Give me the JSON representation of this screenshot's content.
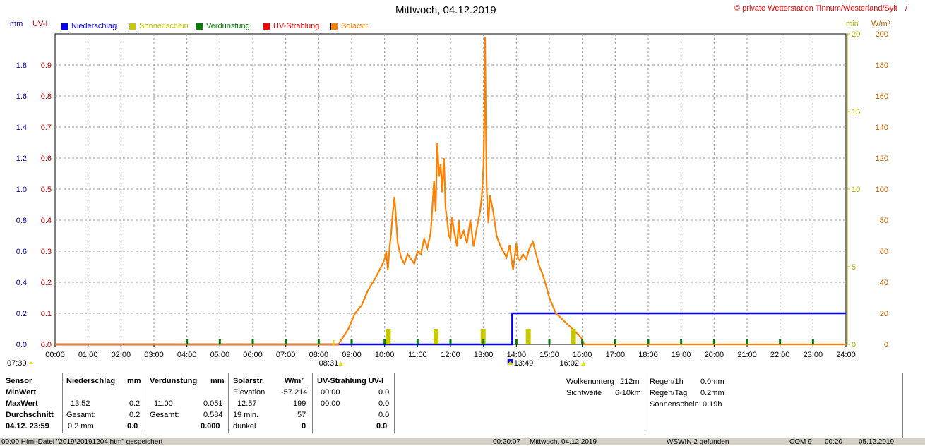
{
  "title": "Mittwoch, 04.12.2019",
  "copyright": "© private Wetterstation Tinnum/Westerland/Sylt",
  "copyright_tail": "/",
  "units": {
    "left1": "mm",
    "left2": "UV-I",
    "right1": "min",
    "right2": "W/m²"
  },
  "legend": [
    {
      "label": "Niederschlag",
      "color": "#0000ff",
      "text_color": "#0000ff"
    },
    {
      "label": "Sonnenschein",
      "color": "#c8c800",
      "text_color": "#c8c800"
    },
    {
      "label": "Verdunstung",
      "color": "#008000",
      "text_color": "#008000"
    },
    {
      "label": "UV-Strahlung",
      "color": "#ff0000",
      "text_color": "#ff0000"
    },
    {
      "label": "Solarstr.",
      "color": "#ff8000",
      "text_color": "#ff8000"
    }
  ],
  "colors": {
    "grid": "#999999",
    "mm_axis": "#0000a0",
    "uv_axis": "#c00000",
    "min_axis": "#b0b000",
    "wm_axis": "#c06000"
  },
  "chart_data": {
    "type": "line",
    "x_axis": {
      "ticks": [
        "00:00",
        "01:00",
        "02:00",
        "03:00",
        "04:00",
        "05:00",
        "06:00",
        "07:00",
        "08:00",
        "09:00",
        "10:00",
        "11:00",
        "12:00",
        "13:00",
        "14:00",
        "15:00",
        "16:00",
        "17:00",
        "18:00",
        "19:00",
        "20:00",
        "21:00",
        "22:00",
        "23:00",
        "24:00"
      ],
      "range_hours": [
        0,
        24
      ]
    },
    "y_left_mm": {
      "ticks": [
        "0.0",
        "0.2",
        "0.4",
        "0.6",
        "0.8",
        "1.0",
        "1.2",
        "1.4",
        "1.6",
        "1.8"
      ],
      "range": [
        0,
        2.0
      ]
    },
    "y_left_uv": {
      "ticks": [
        "0.0",
        "0.1",
        "0.2",
        "0.3",
        "0.4",
        "0.5",
        "0.6",
        "0.7",
        "0.8",
        "0.9"
      ],
      "range": [
        0,
        1.0
      ]
    },
    "y_right_min": {
      "ticks": [
        "0",
        "5",
        "10",
        "15",
        "20"
      ],
      "range": [
        0,
        20
      ]
    },
    "y_right_wm": {
      "ticks": [
        "0",
        "20",
        "40",
        "60",
        "80",
        "100",
        "120",
        "140",
        "160",
        "180",
        "200"
      ],
      "range": [
        0,
        200
      ]
    },
    "markers": {
      "sunrise": "08:31",
      "sunset": "16:02",
      "sunrise_left": "07:30",
      "max_mark": "13:49"
    },
    "series": [
      {
        "name": "Niederschlag",
        "unit": "mm",
        "color": "#0000ff",
        "points": [
          [
            0,
            0
          ],
          [
            13.87,
            0
          ],
          [
            13.87,
            0.2
          ],
          [
            24,
            0.2
          ]
        ]
      },
      {
        "name": "Solarstr.",
        "unit": "W/m²",
        "color": "#ff8000",
        "points": [
          [
            0,
            0
          ],
          [
            8.6,
            0
          ],
          [
            8.75,
            5
          ],
          [
            8.9,
            10
          ],
          [
            9.1,
            20
          ],
          [
            9.3,
            25
          ],
          [
            9.5,
            35
          ],
          [
            9.7,
            42
          ],
          [
            9.9,
            50
          ],
          [
            10.0,
            55
          ],
          [
            10.05,
            60
          ],
          [
            10.1,
            48
          ],
          [
            10.15,
            62
          ],
          [
            10.2,
            72
          ],
          [
            10.25,
            85
          ],
          [
            10.3,
            95
          ],
          [
            10.35,
            80
          ],
          [
            10.4,
            65
          ],
          [
            10.5,
            56
          ],
          [
            10.6,
            52
          ],
          [
            10.7,
            58
          ],
          [
            10.8,
            55
          ],
          [
            10.9,
            52
          ],
          [
            11.0,
            60
          ],
          [
            11.1,
            58
          ],
          [
            11.2,
            68
          ],
          [
            11.3,
            62
          ],
          [
            11.4,
            72
          ],
          [
            11.5,
            105
          ],
          [
            11.55,
            85
          ],
          [
            11.6,
            130
          ],
          [
            11.65,
            108
          ],
          [
            11.7,
            116
          ],
          [
            11.75,
            98
          ],
          [
            11.8,
            120
          ],
          [
            11.85,
            88
          ],
          [
            11.9,
            80
          ],
          [
            11.95,
            70
          ],
          [
            12.0,
            68
          ],
          [
            12.05,
            82
          ],
          [
            12.1,
            74
          ],
          [
            12.2,
            63
          ],
          [
            12.25,
            80
          ],
          [
            12.3,
            68
          ],
          [
            12.4,
            73
          ],
          [
            12.5,
            65
          ],
          [
            12.6,
            80
          ],
          [
            12.7,
            63
          ],
          [
            12.8,
            75
          ],
          [
            12.9,
            86
          ],
          [
            12.95,
            95
          ],
          [
            13.0,
            115
          ],
          [
            13.03,
            150
          ],
          [
            13.05,
            198
          ],
          [
            13.08,
            130
          ],
          [
            13.1,
            100
          ],
          [
            13.15,
            78
          ],
          [
            13.2,
            96
          ],
          [
            13.3,
            85
          ],
          [
            13.4,
            70
          ],
          [
            13.5,
            64
          ],
          [
            13.6,
            60
          ],
          [
            13.7,
            56
          ],
          [
            13.8,
            64
          ],
          [
            13.85,
            55
          ],
          [
            13.9,
            48
          ],
          [
            14.0,
            65
          ],
          [
            14.05,
            55
          ],
          [
            14.1,
            54
          ],
          [
            14.2,
            58
          ],
          [
            14.3,
            55
          ],
          [
            14.4,
            62
          ],
          [
            14.5,
            66
          ],
          [
            14.6,
            58
          ],
          [
            14.7,
            50
          ],
          [
            14.8,
            45
          ],
          [
            14.9,
            38
          ],
          [
            15.0,
            30
          ],
          [
            15.1,
            25
          ],
          [
            15.2,
            20
          ],
          [
            15.3,
            18
          ],
          [
            15.4,
            16
          ],
          [
            15.5,
            14
          ],
          [
            15.6,
            12
          ],
          [
            15.7,
            10
          ],
          [
            15.8,
            8
          ],
          [
            15.9,
            6
          ],
          [
            16.0,
            3
          ],
          [
            16.05,
            0
          ],
          [
            24,
            0
          ]
        ]
      },
      {
        "name": "Sonnenschein",
        "unit": "min",
        "color": "#c8c800",
        "bars": [
          [
            10.1,
            1
          ],
          [
            11.55,
            1
          ],
          [
            12.98,
            1
          ],
          [
            14.35,
            1
          ],
          [
            15.72,
            1
          ]
        ]
      },
      {
        "name": "Verdunstung",
        "unit": "mm",
        "color": "#008000",
        "ticks_hours": [
          4,
          5,
          6,
          7,
          8,
          9,
          10,
          11,
          12,
          13,
          14,
          15,
          16,
          17,
          18,
          19,
          20,
          21,
          22,
          23
        ]
      }
    ]
  },
  "table": {
    "sensor_header": "Sensor",
    "rows_labels": [
      "MinWert",
      "MaxWert",
      "Durchschnitt"
    ],
    "date_label": "04.12. 23:59",
    "niederschlag": {
      "header": "Niederschlag",
      "unit": "mm",
      "max_time": "13:52",
      "max_val": "0.2",
      "gesamt_label": "Gesamt:",
      "gesamt_val": "0.2",
      "avg": "0.2 mm",
      "avg_val": "0.0"
    },
    "verdunstung": {
      "header": "Verdunstung",
      "unit": "mm",
      "max_time": "11:00",
      "max_val": "0.051",
      "gesamt_label": "Gesamt:",
      "gesamt_val": "0.584",
      "avg_val": "0.000"
    },
    "solar": {
      "header": "Solarstr.",
      "unit": "W/m²",
      "elev_label": "Elevation",
      "elev_val": "-57.214",
      "max_time": "12:57",
      "max_val": "199",
      "dur_label": "19 min.",
      "dur_val": "57",
      "dark_label": "dunkel",
      "dark_val": "0"
    },
    "uv": {
      "header": "UV-Strahlung UV-I",
      "min_time": "00:00",
      "min_val": "0.0",
      "max_time": "00:00",
      "max_val": "0.0",
      "g_val": "0.0",
      "avg_val": "0.0"
    },
    "cloud": {
      "label": "Wolkenunterg",
      "value": "212m",
      "vis_label": "Sichtweite",
      "vis_value": "6-10km"
    },
    "rain": {
      "h1_label": "Regen/1h",
      "h1_value": "0.0mm",
      "day_label": "Regen/Tag",
      "day_value": "0.2mm",
      "sun_label": "Sonnenschein",
      "sun_value": "0:19h"
    }
  },
  "statusbar": {
    "seg1": "00:00 Html-Datei \"2019\\20191204.htm\" gespeichert",
    "seg2": "00:20:07",
    "seg3": "Mittwoch, 04.12.2019",
    "seg4": "WSWIN 2 gefunden",
    "seg5": "COM 9",
    "seg6": "00:20",
    "seg7": "05.12.2019"
  }
}
